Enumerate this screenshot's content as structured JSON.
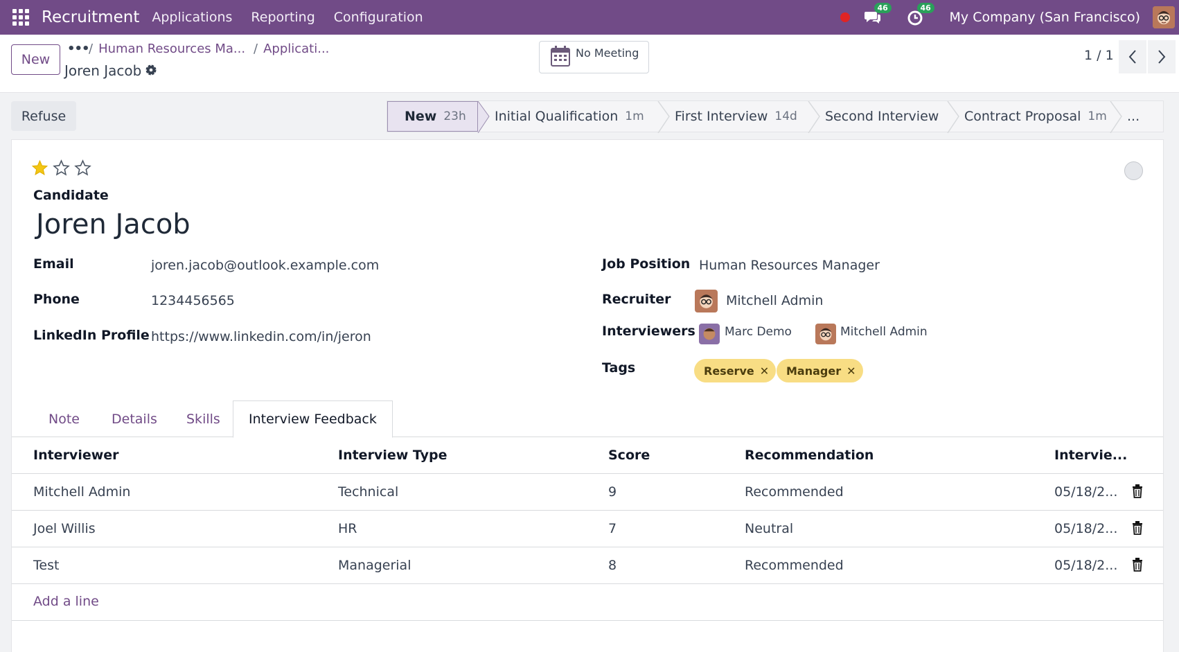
{
  "nav": {
    "app_title": "Recruitment",
    "menu": [
      "Applications",
      "Reporting",
      "Configuration"
    ],
    "chat_badge": "46",
    "activity_badge": "46",
    "company": "My Company (San Francisco)"
  },
  "control": {
    "new_label": "New",
    "breadcrumb_dots": "•••",
    "breadcrumbs": [
      "Human Resources Ma...",
      "Applicati..."
    ],
    "record_name": "Joren Jacob",
    "meeting_label": "No Meeting",
    "pager": "1 / 1"
  },
  "statusbar": {
    "refuse_label": "Refuse",
    "stages": [
      {
        "label": "New",
        "duration": "23h",
        "active": true
      },
      {
        "label": "Initial Qualification",
        "duration": "1m",
        "active": false
      },
      {
        "label": "First Interview",
        "duration": "14d",
        "active": false
      },
      {
        "label": "Second Interview",
        "duration": "",
        "active": false
      },
      {
        "label": "Contract Proposal",
        "duration": "1m",
        "active": false
      }
    ],
    "more_label": "..."
  },
  "form": {
    "priority_stars": 1,
    "priority_max": 3,
    "candidate_label": "Candidate",
    "candidate_name": "Joren Jacob",
    "email_label": "Email",
    "email": "joren.jacob@outlook.example.com",
    "phone_label": "Phone",
    "phone": "1234456565",
    "linkedin_label": "LinkedIn Profile",
    "linkedin": "https://www.linkedin.com/in/jeron",
    "job_position_label": "Job Position",
    "job_position": "Human Resources Manager",
    "recruiter_label": "Recruiter",
    "recruiter": "Mitchell Admin",
    "interviewers_label": "Interviewers",
    "interviewers": [
      "Marc Demo",
      "Mitchell Admin"
    ],
    "tags_label": "Tags",
    "tags": [
      "Reserve",
      "Manager"
    ],
    "tag_remove": "✕"
  },
  "tabs": [
    "Note",
    "Details",
    "Skills",
    "Interview Feedback"
  ],
  "feedback": {
    "headers": [
      "Interviewer",
      "Interview Type",
      "Score",
      "Recommendation",
      "Intervie..."
    ],
    "rows": [
      [
        "Mitchell Admin",
        "Technical",
        "9",
        "Recommended",
        "05/18/2..."
      ],
      [
        "Joel Willis",
        "HR",
        "7",
        "Neutral",
        "05/18/2..."
      ],
      [
        "Test",
        "Managerial",
        "8",
        "Recommended",
        "05/18/2..."
      ]
    ],
    "add_line": "Add a line"
  },
  "colors": {
    "brand": "#714b87",
    "tag": "#f8dd84",
    "star": "#f3c614",
    "badge": "#2aa05a"
  }
}
